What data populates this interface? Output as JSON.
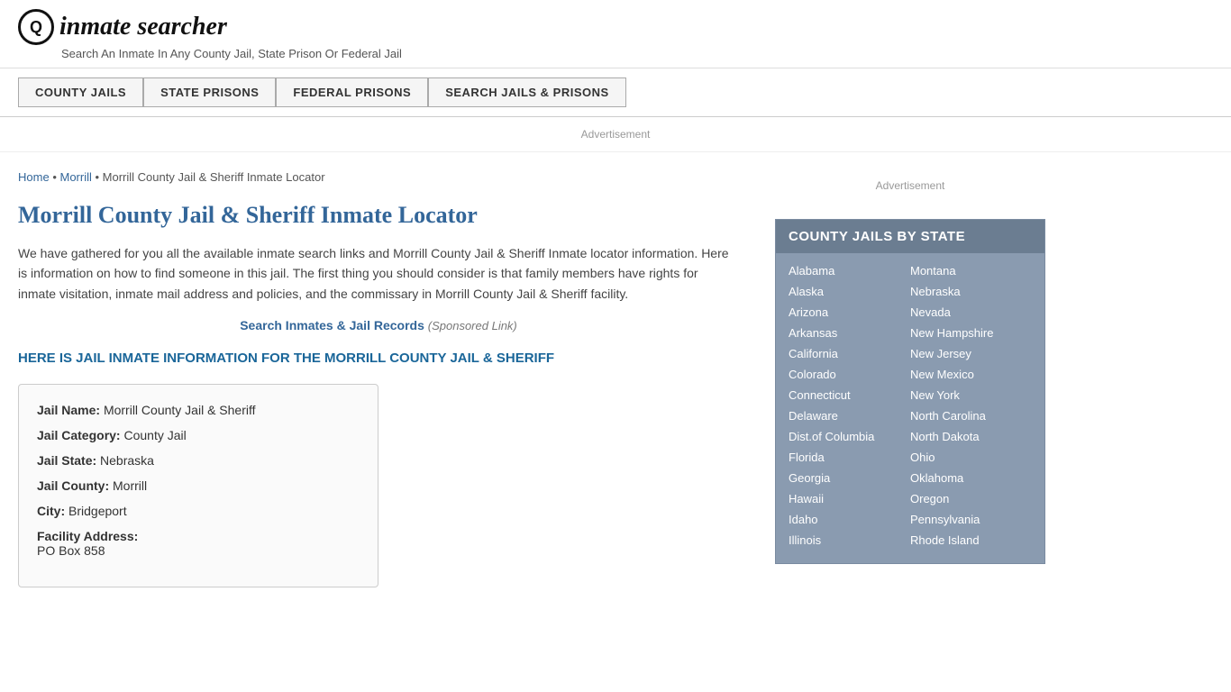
{
  "header": {
    "logo_icon": "Q",
    "logo_text": "inmate searcher",
    "tagline": "Search An Inmate In Any County Jail, State Prison Or Federal Jail"
  },
  "nav": {
    "buttons": [
      {
        "label": "COUNTY JAILS",
        "id": "county-jails"
      },
      {
        "label": "STATE PRISONS",
        "id": "state-prisons"
      },
      {
        "label": "FEDERAL PRISONS",
        "id": "federal-prisons"
      },
      {
        "label": "SEARCH JAILS & PRISONS",
        "id": "search-jails"
      }
    ]
  },
  "ad_top": "Advertisement",
  "breadcrumb": {
    "home": "Home",
    "morrill": "Morrill",
    "current": "Morrill County Jail & Sheriff Inmate Locator"
  },
  "page_title": "Morrill County Jail & Sheriff Inmate Locator",
  "description": "We have gathered for you all the available inmate search links and Morrill County Jail & Sheriff Inmate locator information. Here is information on how to find someone in this jail. The first thing you should consider is that family members have rights for inmate visitation, inmate mail address and policies, and the commissary in Morrill County Jail & Sheriff facility.",
  "sponsored": {
    "link_text": "Search Inmates & Jail Records",
    "label": "(Sponsored Link)"
  },
  "section_heading": "HERE IS JAIL INMATE INFORMATION FOR THE MORRILL COUNTY JAIL & SHERIFF",
  "info": {
    "jail_name_label": "Jail Name:",
    "jail_name_value": "Morrill County Jail & Sheriff",
    "jail_category_label": "Jail Category:",
    "jail_category_value": "County Jail",
    "jail_state_label": "Jail State:",
    "jail_state_value": "Nebraska",
    "jail_county_label": "Jail County:",
    "jail_county_value": "Morrill",
    "city_label": "City:",
    "city_value": "Bridgeport",
    "facility_address_label": "Facility Address:",
    "facility_address_value": "PO Box 858"
  },
  "sidebar": {
    "ad_label": "Advertisement",
    "state_box_title": "COUNTY JAILS BY STATE",
    "states_left": [
      "Alabama",
      "Alaska",
      "Arizona",
      "Arkansas",
      "California",
      "Colorado",
      "Connecticut",
      "Delaware",
      "Dist.of Columbia",
      "Florida",
      "Georgia",
      "Hawaii",
      "Idaho",
      "Illinois"
    ],
    "states_right": [
      "Montana",
      "Nebraska",
      "Nevada",
      "New Hampshire",
      "New Jersey",
      "New Mexico",
      "New York",
      "North Carolina",
      "North Dakota",
      "Ohio",
      "Oklahoma",
      "Oregon",
      "Pennsylvania",
      "Rhode Island"
    ]
  }
}
